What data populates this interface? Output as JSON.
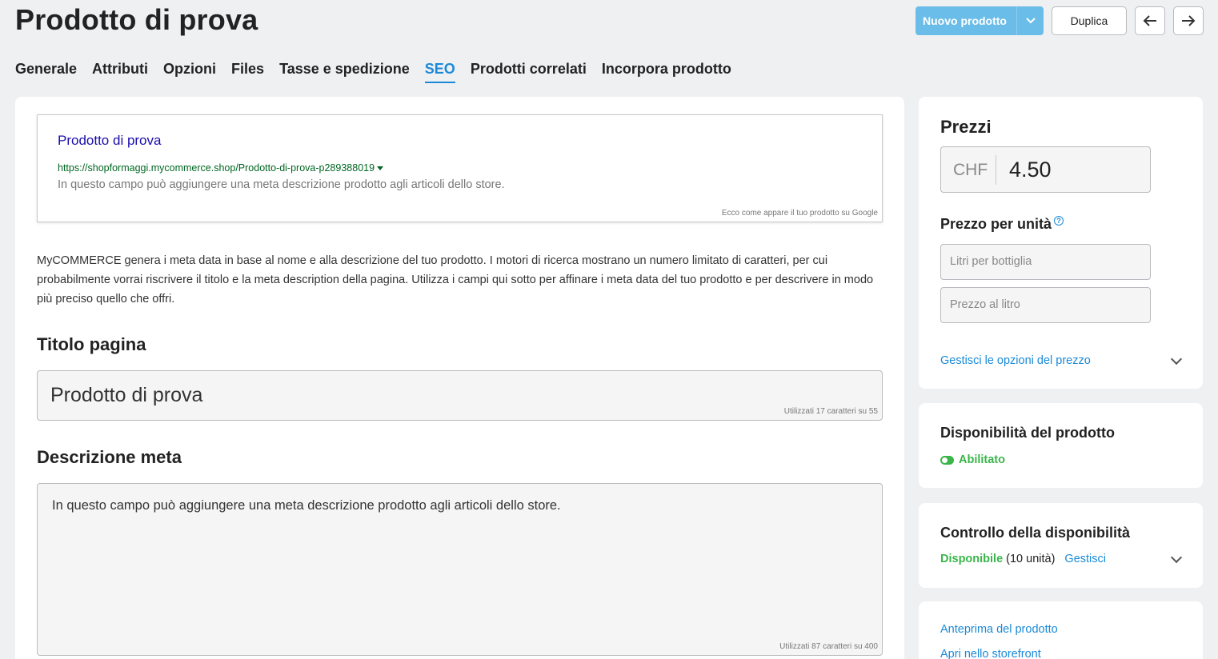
{
  "header": {
    "title": "Prodotto di prova",
    "new_product_label": "Nuovo prodotto",
    "duplicate_label": "Duplica"
  },
  "tabs": [
    {
      "label": "Generale",
      "active": false
    },
    {
      "label": "Attributi",
      "active": false
    },
    {
      "label": "Opzioni",
      "active": false
    },
    {
      "label": "Files",
      "active": false
    },
    {
      "label": "Tasse e spedizione",
      "active": false
    },
    {
      "label": "SEO",
      "active": true
    },
    {
      "label": "Prodotti correlati",
      "active": false
    },
    {
      "label": "Incorpora prodotto",
      "active": false
    }
  ],
  "seo": {
    "preview": {
      "title": "Prodotto di prova",
      "url": "https://shopformaggi.mycommerce.shop/Prodotto-di-prova-p289388019",
      "description": "In questo campo può aggiungere una meta descrizione prodotto agli articoli dello store.",
      "note": "Ecco come appare il tuo prodotto su Google"
    },
    "intro": "MyCOMMERCE genera i meta data in base al nome e alla descrizione del tuo prodotto. I motori di ricerca mostrano un numero limitato di caratteri, per cui probabilmente vorrai riscrivere il titolo e la meta description della pagina. Utilizza i campi qui sotto per affinare i meta data del tuo prodotto e per descrivere in modo più preciso quello che offri.",
    "page_title_heading": "Titolo pagina",
    "page_title_value": "Prodotto di prova",
    "page_title_counter": "Utilizzati 17 caratteri su 55",
    "meta_heading": "Descrizione meta",
    "meta_value": "In questo campo può aggiungere una meta descrizione prodotto agli articoli dello store.",
    "meta_counter": "Utilizzati 87 caratteri su 400"
  },
  "prices": {
    "heading": "Prezzi",
    "currency": "CHF",
    "amount": "4.50",
    "unit_heading": "Prezzo per unità",
    "unit_placeholder_1": "Litri per bottiglia",
    "unit_placeholder_2": "Prezzo al litro",
    "options_link": "Gestisci le opzioni del prezzo"
  },
  "availability": {
    "heading": "Disponibilità del prodotto",
    "status": "Abilitato"
  },
  "stock": {
    "heading": "Controllo della disponibilità",
    "status": "Disponibile",
    "units": "(10 unità)",
    "manage_link": "Gestisci"
  },
  "links": {
    "preview": "Anteprima del prodotto",
    "storefront": "Apri nello storefront"
  },
  "colors": {
    "accent": "#1a8ad8",
    "primary_button": "#6bbde9",
    "success": "#3ab54a",
    "google_title": "#1a0dab",
    "google_url": "#006621"
  }
}
